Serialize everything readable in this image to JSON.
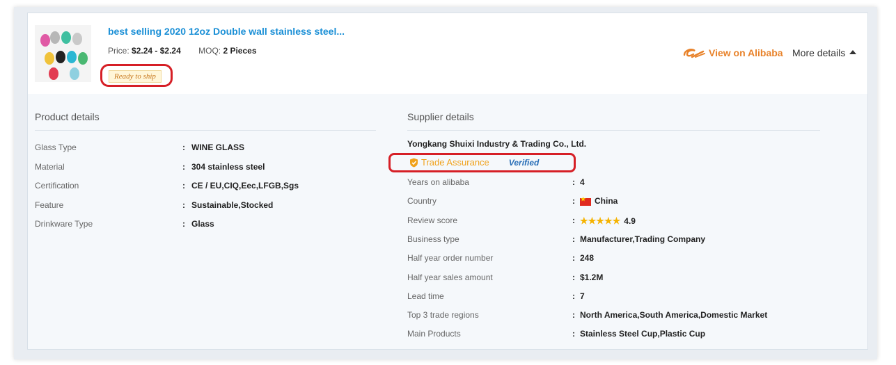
{
  "product": {
    "title": "best selling 2020 12oz Double wall stainless steel...",
    "price_label": "Price:",
    "price_value": "$2.24 - $2.24",
    "moq_label": "MOQ:",
    "moq_value": "2 Pieces",
    "ready_to_ship": "Ready to ship",
    "image_alt": "colorful stemless wine tumblers",
    "image_colors": [
      "#e05aa5",
      "#b7b7b7",
      "#3fbfa0",
      "#c9c9c9",
      "#f0c23a",
      "#222222",
      "#2ab7d3",
      "#4ab872",
      "#e23c52",
      "#8fd0e0"
    ]
  },
  "header": {
    "alibaba_link": "View on Alibaba",
    "alibaba_icon": "alibaba-logo-icon",
    "more_details": "More details"
  },
  "product_details": {
    "title": "Product details",
    "rows": [
      {
        "label": "Glass Type",
        "value": "WINE GLASS"
      },
      {
        "label": "Material",
        "value": "304 stainless steel"
      },
      {
        "label": "Certification",
        "value": "CE / EU,CIQ,Eec,LFGB,Sgs"
      },
      {
        "label": "Feature",
        "value": "Sustainable,Stocked"
      },
      {
        "label": "Drinkware Type",
        "value": "Glass"
      }
    ]
  },
  "supplier_details": {
    "title": "Supplier details",
    "name": "Yongkang Shuixi Industry & Trading Co., Ltd.",
    "trade_assurance": "Trade Assurance",
    "verified": "Verified",
    "rows": [
      {
        "label": "Years on alibaba",
        "value": "4"
      },
      {
        "label": "Country",
        "value": "China"
      },
      {
        "label": "Review score",
        "value": "4.9",
        "stars": "★★★★★"
      },
      {
        "label": "Business type",
        "value": "Manufacturer,Trading Company"
      },
      {
        "label": "Half year order number",
        "value": "248"
      },
      {
        "label": "Half year sales amount",
        "value": "$1.2M"
      },
      {
        "label": "Lead time",
        "value": "7"
      },
      {
        "label": "Top 3 trade regions",
        "value": "North America,South America,Domestic Market"
      },
      {
        "label": "Main Products",
        "value": "Stainless Steel Cup,Plastic Cup"
      }
    ]
  },
  "colors": {
    "title_blue": "#1a8fd6",
    "alibaba_orange": "#e8822a",
    "highlight_red": "#d61f26",
    "trade_assurance_gold": "#f0a21c"
  }
}
